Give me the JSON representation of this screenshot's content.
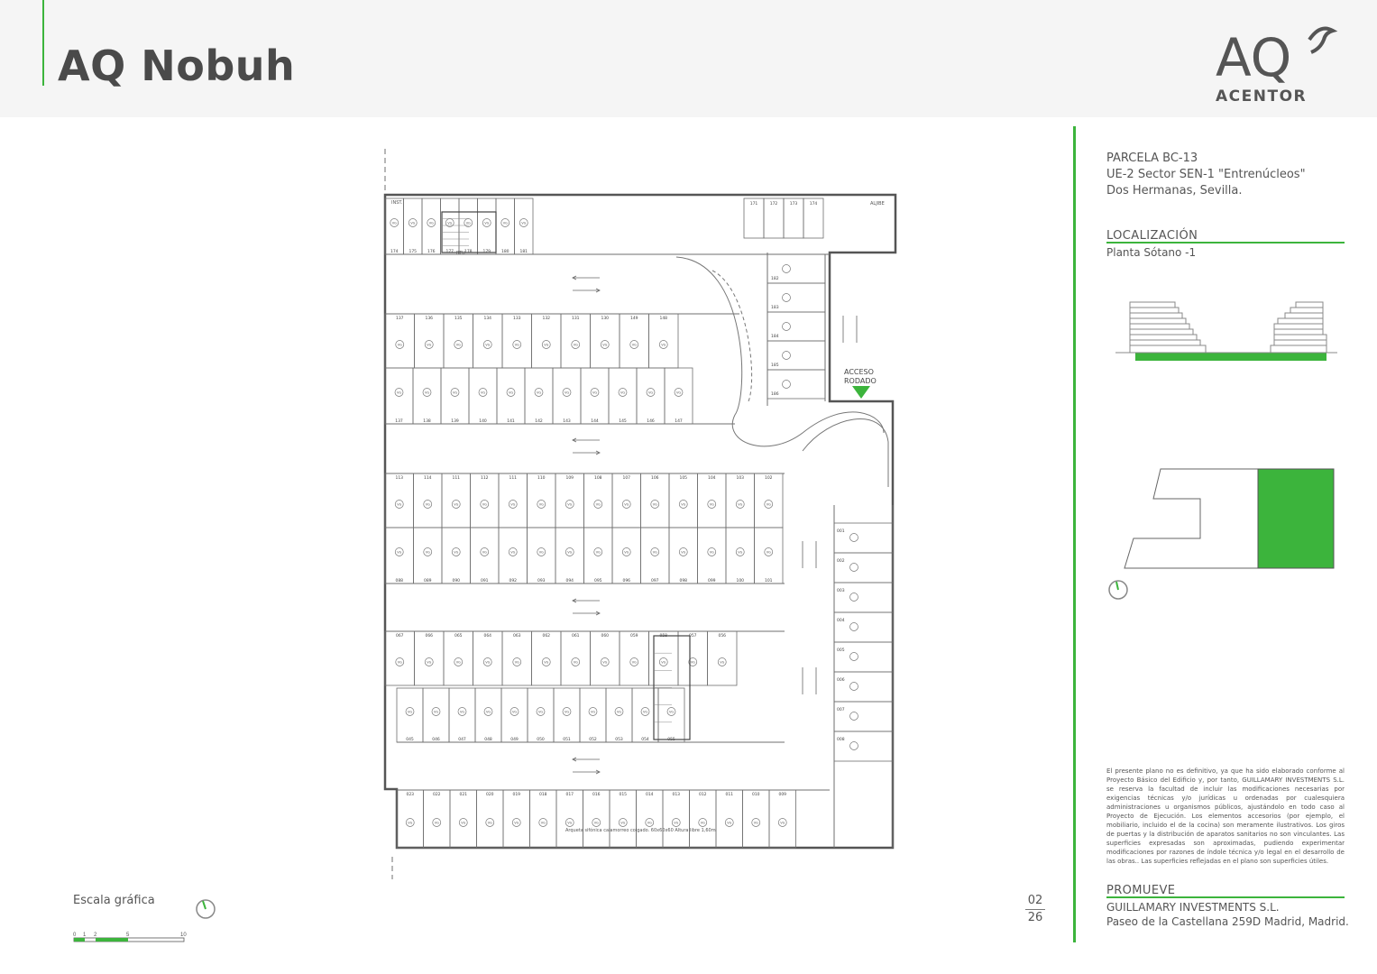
{
  "header": {
    "title": "AQ Nobuh",
    "logo_mark": "AQ",
    "logo_name": "ACENTOR"
  },
  "sidebar": {
    "address": [
      "PARCELA BC-13",
      "UE-2 Sector SEN-1 \"Entrenúcleos\"",
      "Dos Hermanas, Sevilla."
    ],
    "location_title": "LOCALIZACIÓN",
    "location_value": "Planta Sótano -1",
    "disclaimer": "El presente plano no es definitivo, ya que ha sido elaborado conforme al Proyecto Básico del Edificio y, por tanto, GUILLAMARY INVESTMENTS S.L. se reserva la facultad de incluir las modificaciones necesarias por exigencias técnicas y/o jurídicas u ordenadas por cualesquiera administraciones u organismos públicos, ajustándolo en todo caso al Proyecto de Ejecución. Los elementos accesorios (por ejemplo, el mobiliario, incluido el de la cocina) son meramente ilustrativos. Los giros de puertas y la distribución de aparatos sanitarios no son vinculantes. Las superficies expresadas son aproximadas, pudiendo experimentar modificaciones por razones de índole técnica y/o legal en el desarrollo de las obras.. Las superficies reflejadas en el plano son superficies útiles.",
    "promoter_title": "PROMUEVE",
    "promoter_name": "GUILLAMARY INVESTMENTS S.L.",
    "promoter_address": "Paseo de la Castellana 259D Madrid, Madrid."
  },
  "footer": {
    "scale_label": "Escala gráfica",
    "scale_ticks": [
      "0",
      "1",
      "2",
      "5",
      "10"
    ],
    "page_current": "02",
    "page_total": "26"
  },
  "plan": {
    "access_label_1": "ACCESO",
    "access_label_2": "RODADO",
    "space_tag": "VG",
    "inst_label": "INST.",
    "rtu_label": "RTU",
    "aljibe_label": "ALJIBE",
    "row_top_numbers": [
      "174",
      "175",
      "176",
      "177",
      "178",
      "179",
      "180",
      "181"
    ],
    "row_top_cells": [
      "171",
      "172",
      "173",
      "174"
    ],
    "row_a_numbers": [
      "137",
      "136",
      "135",
      "134",
      "133",
      "132",
      "131",
      "130",
      "149",
      "148"
    ],
    "row_b_numbers": [
      "137",
      "138",
      "139",
      "140",
      "141",
      "142",
      "143",
      "144",
      "145",
      "146",
      "147"
    ],
    "row_c_numbers": [
      "113",
      "114",
      "111",
      "112",
      "111",
      "110",
      "109",
      "108",
      "107",
      "106",
      "105",
      "104",
      "103",
      "102"
    ],
    "row_d_numbers": [
      "088",
      "089",
      "090",
      "091",
      "092",
      "093",
      "094",
      "095",
      "096",
      "097",
      "098",
      "099",
      "100",
      "101"
    ],
    "row_e_numbers": [
      "067",
      "066",
      "065",
      "064",
      "063",
      "062",
      "061",
      "060",
      "059",
      "058",
      "057",
      "056"
    ],
    "row_f_numbers": [
      "045",
      "046",
      "047",
      "048",
      "049",
      "050",
      "051",
      "052",
      "053",
      "054",
      "055"
    ],
    "row_g_numbers": [
      "023",
      "022",
      "021",
      "020",
      "019",
      "018",
      "017",
      "016",
      "015",
      "014",
      "013",
      "012",
      "011",
      "010",
      "009"
    ],
    "col_right_numbers": [
      "182",
      "183",
      "184",
      "185",
      "186"
    ],
    "col_east_numbers": [
      "001",
      "002",
      "003",
      "004",
      "005",
      "006",
      "007",
      "008"
    ],
    "note": "Arqueta sifónica calamorreo colgado. 60x60x60 Altura libre 1,60m"
  },
  "colors": {
    "accent": "#3cb43c",
    "text": "#4a4a4a",
    "lines": "#6f6f6f"
  }
}
